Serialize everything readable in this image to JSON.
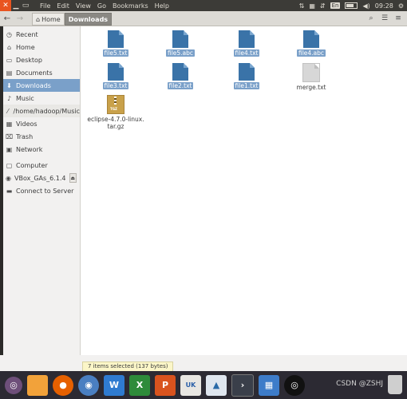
{
  "topbar": {
    "menu": [
      "File",
      "Edit",
      "View",
      "Go",
      "Bookmarks",
      "Help"
    ],
    "input_method": "En",
    "clock": "09:28"
  },
  "toolbar": {
    "crumbs": [
      {
        "label": "Home"
      },
      {
        "label": "Downloads"
      }
    ]
  },
  "sidebar": {
    "items": [
      {
        "label": "Recent",
        "icon": "clock-icon"
      },
      {
        "label": "Home",
        "icon": "home-icon"
      },
      {
        "label": "Desktop",
        "icon": "desktop-icon"
      },
      {
        "label": "Documents",
        "icon": "documents-icon"
      },
      {
        "label": "Downloads",
        "icon": "download-icon"
      },
      {
        "label": "Music",
        "icon": "music-icon"
      },
      {
        "label": "/home/hadoop/Music",
        "icon": "bookmark-icon"
      },
      {
        "label": "Videos",
        "icon": "videos-icon"
      },
      {
        "label": "Trash",
        "icon": "trash-icon"
      },
      {
        "label": "Network",
        "icon": "network-icon"
      },
      {
        "label": "Computer",
        "icon": "computer-icon"
      },
      {
        "label": "VBox_GAs_6.1.4",
        "icon": "disc-icon"
      },
      {
        "label": "Connect to Server",
        "icon": "server-icon"
      }
    ]
  },
  "files": [
    {
      "name": "file5.txt",
      "selected": true
    },
    {
      "name": "file5.abc",
      "selected": true
    },
    {
      "name": "file4.txt",
      "selected": true
    },
    {
      "name": "file4.abc",
      "selected": true
    },
    {
      "name": "file3.txt",
      "selected": true
    },
    {
      "name": "file2.txt",
      "selected": true
    },
    {
      "name": "file1.txt",
      "selected": true
    },
    {
      "name": "merge.txt",
      "selected": false
    },
    {
      "name": "eclipse-4.7.0-linux.\ntar.gz",
      "selected": false
    },
    {
      "tgz_tag": "TGZ"
    }
  ],
  "status": "7 items selected  (137 bytes)",
  "dock": {
    "items": [
      "ubuntu-icon",
      "files-icon",
      "firefox-icon",
      "chromium-icon",
      "writer-icon",
      "calc-icon",
      "impress-icon",
      "uk-icon",
      "software-icon",
      "terminal-icon",
      "workspaces-icon",
      "disc-icon"
    ],
    "watermark": "CSDN @ZSHJ"
  }
}
